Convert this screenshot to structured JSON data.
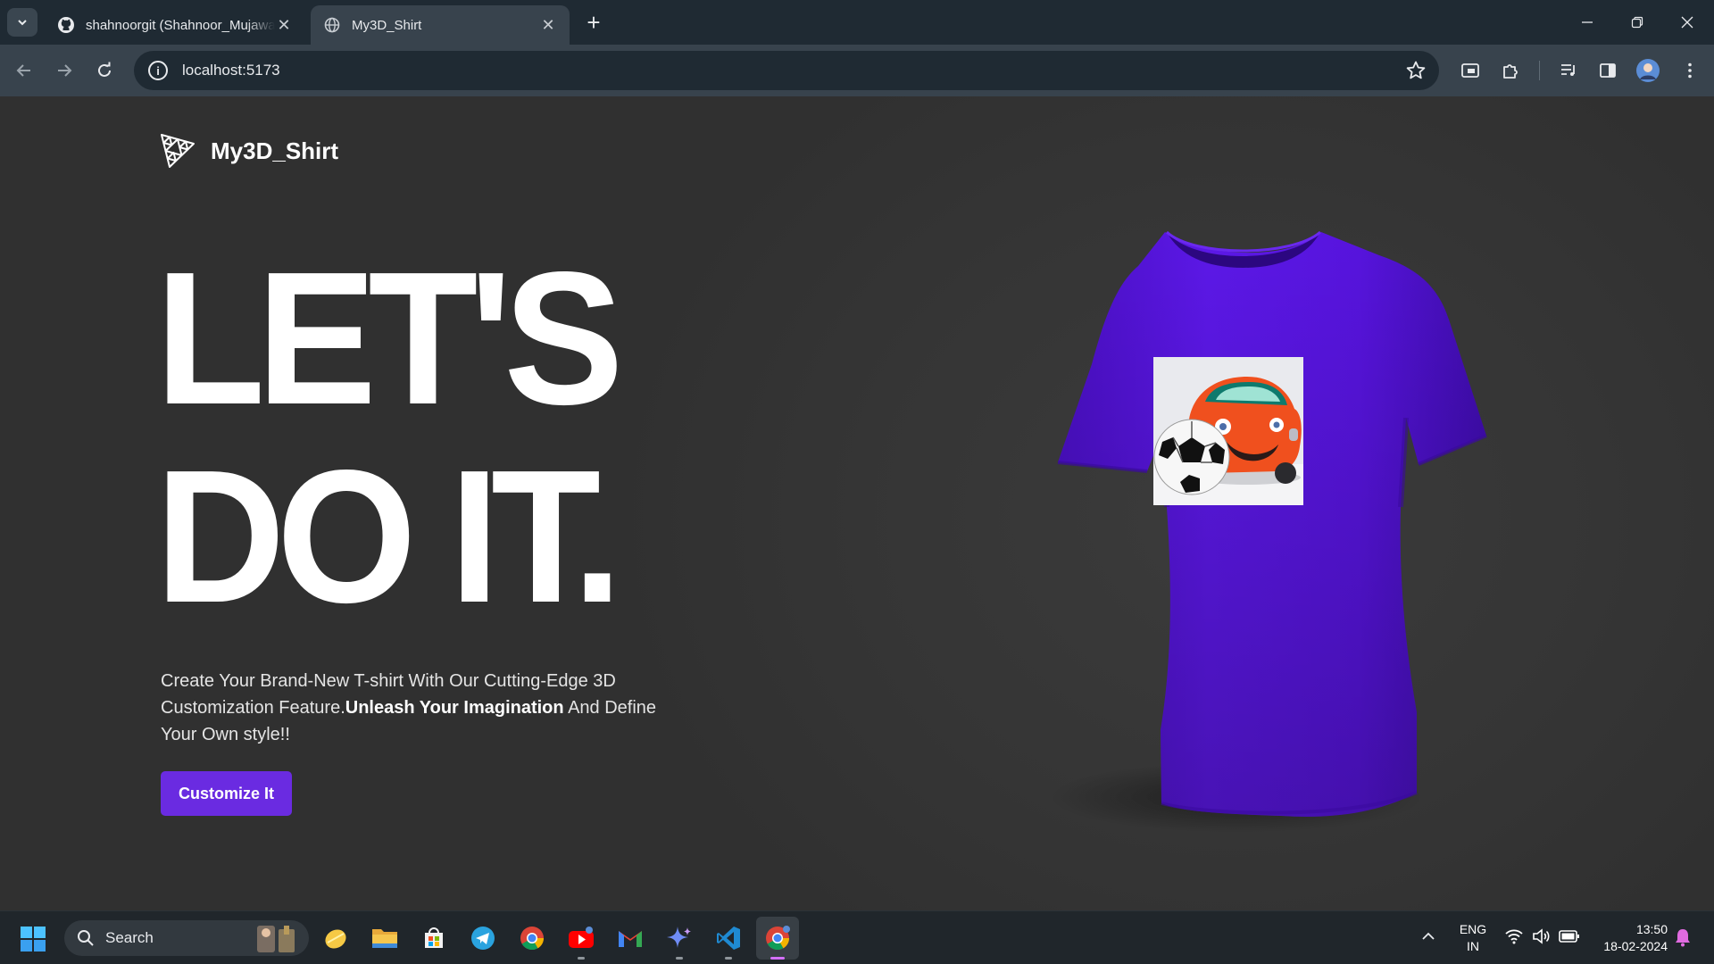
{
  "browser": {
    "tabs": [
      {
        "title": "shahnoorgit (Shahnoor_Mujawar)",
        "favicon": "github-icon",
        "active": false
      },
      {
        "title": "My3D_Shirt",
        "favicon": "globe-icon",
        "active": true
      }
    ],
    "address": "localhost:5173"
  },
  "page": {
    "brand": "My3D_Shirt",
    "hero_line1": "LET'S",
    "hero_line2": "DO IT.",
    "description_part1": "Create Your Brand-New T-shirt With Our Cutting-Edge 3D Customization Feature.",
    "description_bold": "Unleash Your Imagination",
    "description_part2": " And Define Your Own style!!",
    "cta_label": "Customize It",
    "shirt_color": "#5a17e6",
    "accent_color": "#6a2be1"
  },
  "taskbar": {
    "search_label": "Search",
    "apps": [
      "file-explorer-icon",
      "microsoft-store-icon",
      "telegram-icon",
      "chrome-icon",
      "youtube-icon",
      "gmail-icon",
      "gemini-icon",
      "vscode-icon",
      "chrome-icon"
    ],
    "language_line1": "ENG",
    "language_line2": "IN",
    "time": "13:50",
    "date": "18-02-2024"
  }
}
